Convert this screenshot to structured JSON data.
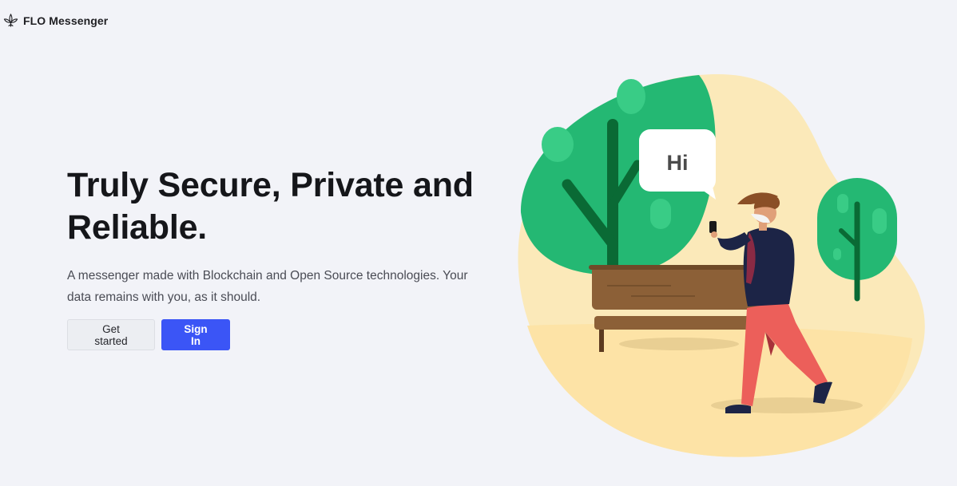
{
  "header": {
    "brand_name": "FLO Messenger",
    "brand_icon": "leaf-logo-icon"
  },
  "hero": {
    "headline_line1": "Truly Secure, Private and",
    "headline_line2": "Reliable.",
    "subtext_line1": "A messenger made with Blockchain and Open Source technologies. Your",
    "subtext_line2": "data remains with you, as it should.",
    "get_started_label": "Get started",
    "sign_in_label": "Sign In"
  },
  "illustration": {
    "speech_bubble_text": "Hi"
  },
  "colors": {
    "background": "#f2f3f8",
    "primary_button": "#3b55f6",
    "tree_green": "#24b873",
    "trunk_green": "#0a6a35",
    "blob_yellow": "#fbe9b9",
    "jacket_navy": "#1c2446",
    "pants_coral": "#ec5f5a",
    "bench_brown": "#8c6037"
  }
}
